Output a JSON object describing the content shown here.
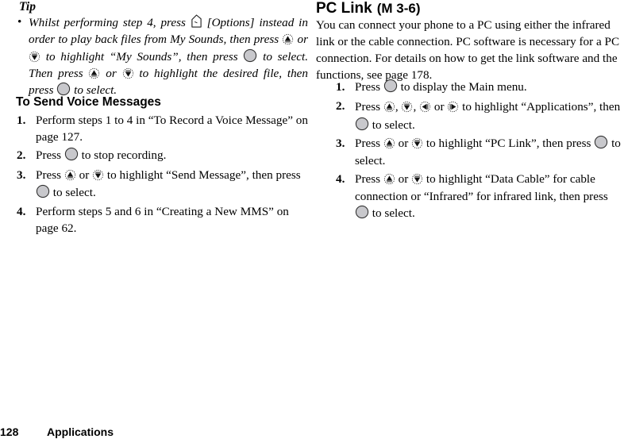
{
  "left": {
    "tip": {
      "title": "Tip",
      "bullet": "•",
      "segments": {
        "s1": "Whilst performing step 4, press",
        "s2": "[Options] instead in order to play back files from My Sounds, then press",
        "s3": "or",
        "s4": "to highlight “My Sounds”, then press",
        "s5": "to select. Then press",
        "s6": "or",
        "s7": "to highlight the desired file, then press",
        "s8": "to select."
      }
    },
    "section": {
      "title": "To Send Voice Messages",
      "steps": [
        {
          "num": "1.",
          "text": "Perform steps 1 to 4 in “To Record a Voice Message” on page 127."
        },
        {
          "num": "2.",
          "a": "Press",
          "b": "to stop recording."
        },
        {
          "num": "3.",
          "a": "Press",
          "b": "or",
          "c": "to highlight “Send Message”, then press",
          "d": "to select."
        },
        {
          "num": "4.",
          "text": "Perform steps 5 and 6 in “Creating a New MMS” on page 62."
        }
      ]
    }
  },
  "right": {
    "title": "PC Link",
    "menu_path": "(M 3-6)",
    "intro": "You can connect your phone to a PC using either the infrared link or the cable connection. PC software is necessary for a PC connection. For details on how to get the link software and the functions, see page 178.",
    "steps": [
      {
        "num": "1.",
        "a": "Press",
        "b": "to display the Main menu."
      },
      {
        "num": "2.",
        "a": "Press",
        "b": ",",
        "c": ",",
        "d": "or",
        "e": "to highlight “Applications”, then",
        "f": "to select."
      },
      {
        "num": "3.",
        "a": "Press",
        "b": "or",
        "c": "to highlight “PC Link”, then press",
        "d": "to select."
      },
      {
        "num": "4.",
        "a": "Press",
        "b": "or",
        "c": "to highlight  “Data Cable” for cable connection or “Infrared” for infrared link, then press",
        "d": "to select."
      }
    ]
  },
  "footer": {
    "page_number": "128",
    "section": "Applications"
  },
  "icons": {
    "center_key": "center-key-icon (gray circle)",
    "up_key": "up-arrow-key-icon",
    "down_key": "down-arrow-key-icon",
    "left_key": "left-arrow-key-icon",
    "right_key": "right-arrow-key-icon",
    "soft_key": "options-soft-key-icon"
  }
}
